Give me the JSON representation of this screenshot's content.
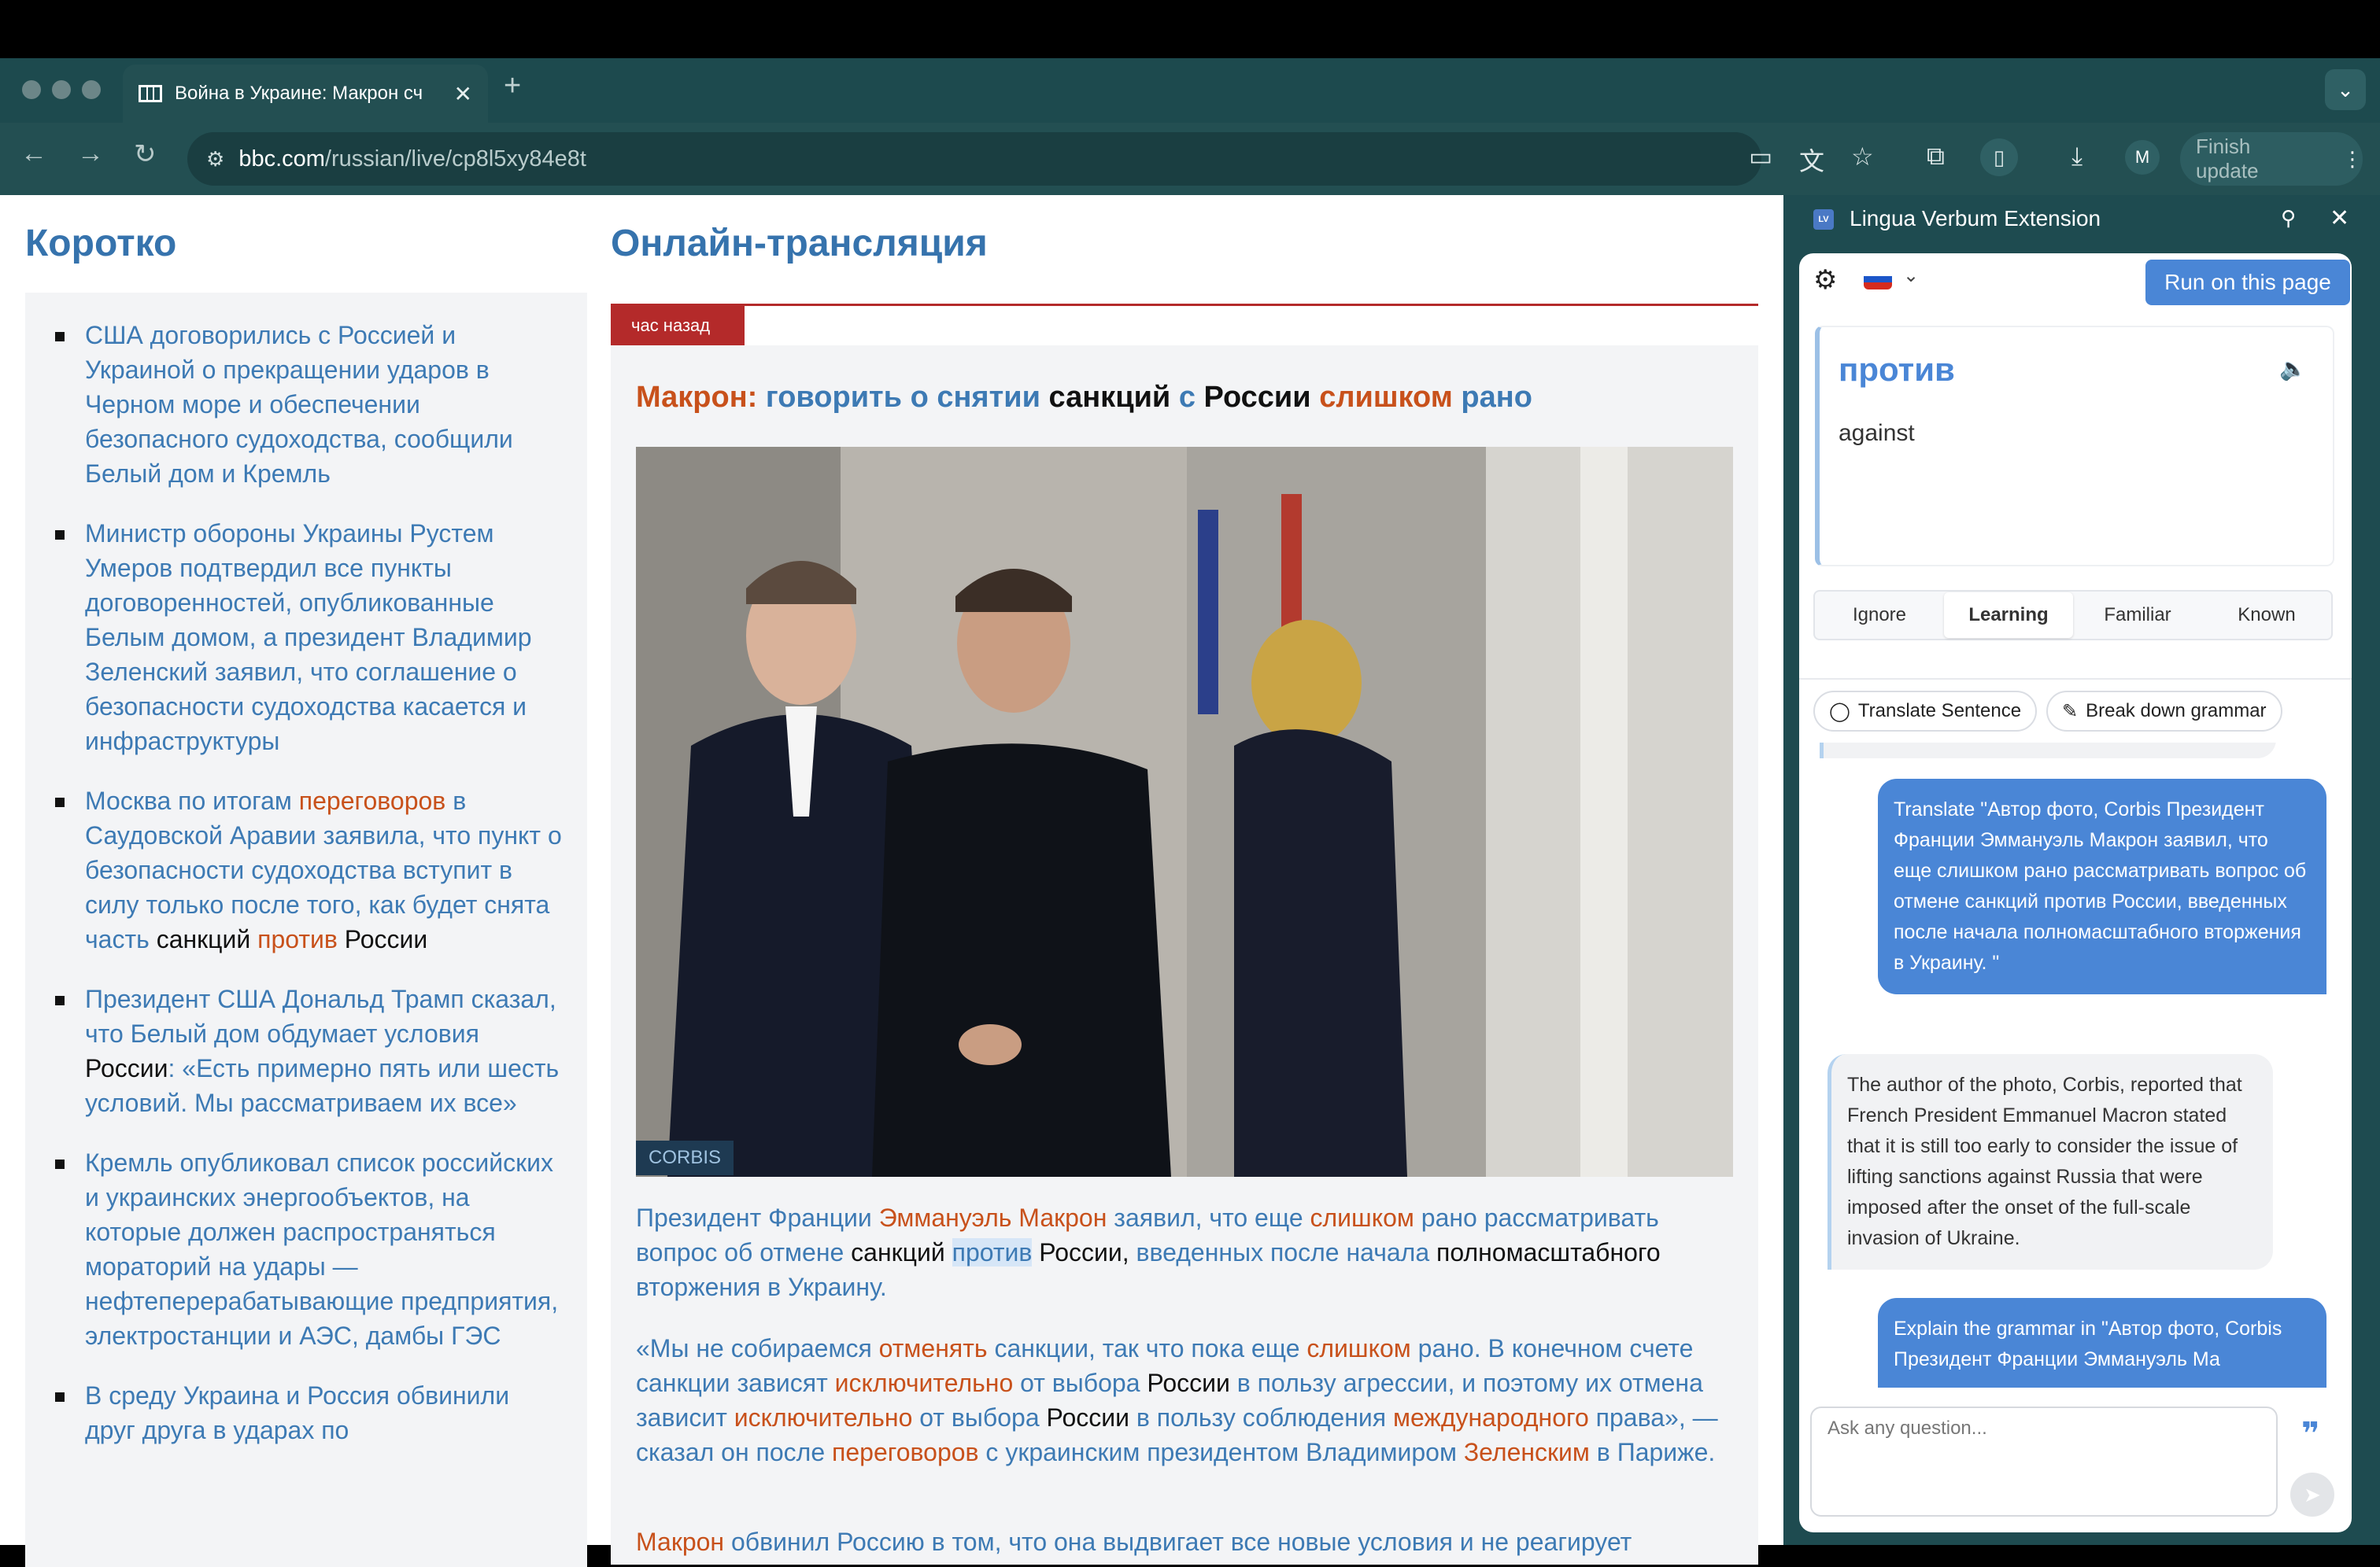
{
  "browser": {
    "tab_title": "Война в Украине: Макрон сч",
    "url_host": "bbc.com",
    "url_path": "/russian/live/cp8l5xy84e8t",
    "avatar_letter": "M",
    "finish_update": "Finish update"
  },
  "page": {
    "left_title": "Коротко",
    "main_title": "Онлайн-трансляция",
    "time_tag": "час назад",
    "photo_credit": "CORBIS"
  },
  "ext": {
    "title": "Lingua Verbum Extension",
    "logo": "LV",
    "run_button": "Run on this page",
    "word": "против",
    "translation": "against",
    "tabs": [
      "Ignore",
      "Learning",
      "Familiar",
      "Known"
    ],
    "translate_sentence": "Translate Sentence",
    "break_grammar": "Break down grammar",
    "msg1": "Translate \"Автор фото, Corbis Президент Франции Эммануэль Макрон заявил, что еще слишком рано рассматривать вопрос об отмене санкций против России, введенных после начала полномасштабного вторжения в Украину. \"",
    "msg2": "The author of the photo, Corbis, reported that French President Emmanuel Macron stated that it is still too early to consider the issue of lifting sanctions against Russia that were imposed after the onset of the full-scale invasion of Ukraine.",
    "msg3": "Explain the grammar in \"Автор фото, Corbis Президент Франции Эммануэль Ма",
    "ask_placeholder": "Ask any question..."
  },
  "colors": {
    "accent": "#4a86d6",
    "link": "#3d7ab4",
    "known_word": "#c8511b",
    "live_red": "#b42a2a"
  }
}
